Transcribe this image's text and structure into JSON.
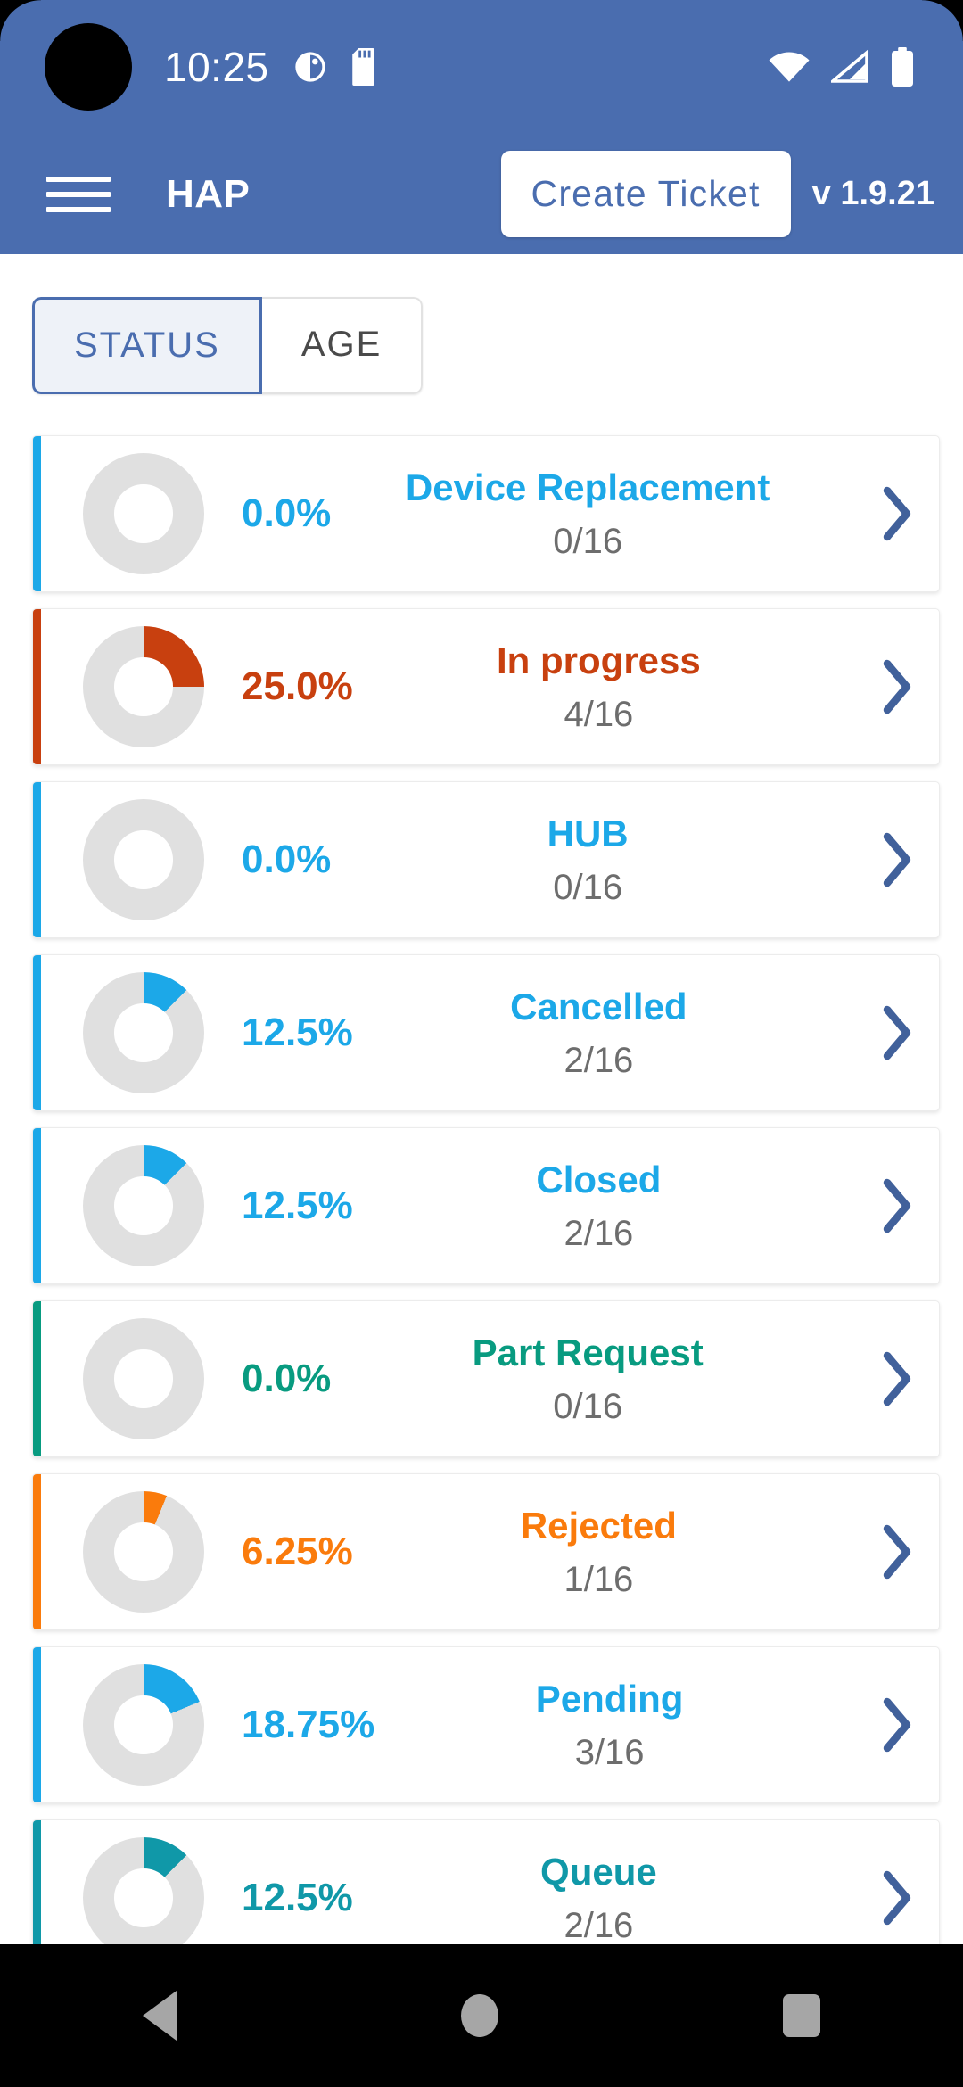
{
  "status_bar": {
    "time": "10:25",
    "icons": [
      "do-not-disturb-icon",
      "sd-card-icon",
      "wifi-icon",
      "cellular-signal-icon",
      "battery-icon"
    ]
  },
  "header": {
    "menu_icon": "hamburger-menu-icon",
    "title": "HAP",
    "create_button": "Create Ticket",
    "version": "v 1.9.21",
    "background": "#4A6DAF"
  },
  "tabs": [
    {
      "label": "STATUS",
      "active": true
    },
    {
      "label": "AGE",
      "active": false
    }
  ],
  "chart_data": {
    "type": "pie",
    "title": "Ticket Status Breakdown",
    "total": 16,
    "categories": [
      "Device Replacement",
      "In progress",
      "HUB",
      "Cancelled",
      "Closed",
      "Part Request",
      "Rejected",
      "Pending",
      "Queue"
    ],
    "values": [
      0,
      4,
      0,
      2,
      2,
      0,
      1,
      3,
      2
    ],
    "percentages": [
      0.0,
      25.0,
      0.0,
      12.5,
      12.5,
      0.0,
      6.25,
      18.75,
      12.5
    ],
    "colors": [
      "#1CA8E8",
      "#C8400F",
      "#1CA8E8",
      "#1CA8E8",
      "#1CA8E8",
      "#089B80",
      "#FA7B0C",
      "#1CA8E8",
      "#1098A8"
    ],
    "track_color": "#E0E0E0",
    "legend": "none",
    "grid": false
  },
  "list": {
    "chevron_icon": "chevron-right-icon",
    "chevron_color": "#41619B",
    "rows": [
      {
        "label": "Device Replacement",
        "percent_text": "0.0%",
        "count_text": "0/16",
        "percent": 0,
        "color": "#1CA8E8"
      },
      {
        "label": "In progress",
        "percent_text": "25.0%",
        "count_text": "4/16",
        "percent": 25,
        "color": "#C8400F"
      },
      {
        "label": "HUB",
        "percent_text": "0.0%",
        "count_text": "0/16",
        "percent": 0,
        "color": "#1CA8E8"
      },
      {
        "label": "Cancelled",
        "percent_text": "12.5%",
        "count_text": "2/16",
        "percent": 12.5,
        "color": "#1CA8E8"
      },
      {
        "label": "Closed",
        "percent_text": "12.5%",
        "count_text": "2/16",
        "percent": 12.5,
        "color": "#1CA8E8"
      },
      {
        "label": "Part Request",
        "percent_text": "0.0%",
        "count_text": "0/16",
        "percent": 0,
        "color": "#089B80"
      },
      {
        "label": "Rejected",
        "percent_text": "6.25%",
        "count_text": "1/16",
        "percent": 6.25,
        "color": "#FA7B0C"
      },
      {
        "label": "Pending",
        "percent_text": "18.75%",
        "count_text": "3/16",
        "percent": 18.75,
        "color": "#1CA8E8"
      },
      {
        "label": "Queue",
        "percent_text": "12.5%",
        "count_text": "2/16",
        "percent": 12.5,
        "color": "#1098A8"
      }
    ]
  },
  "nav_bar": {
    "back": "back-icon",
    "home": "home-icon",
    "recents": "recents-icon"
  }
}
